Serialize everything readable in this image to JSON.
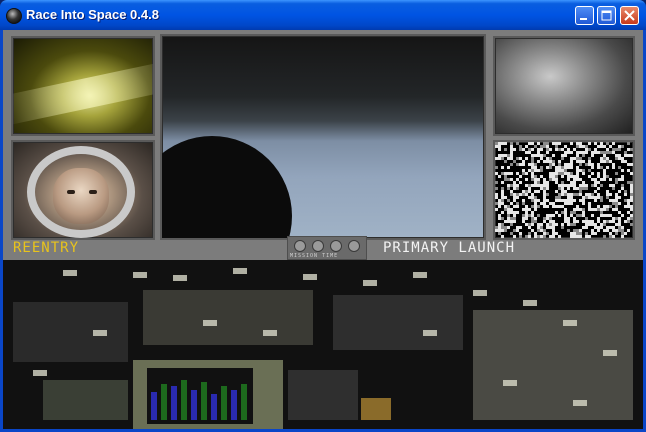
{
  "window": {
    "title": "Race Into Space 0.4.8",
    "icons": {
      "app": "app-icon",
      "minimize": "minimize-icon",
      "maximize": "maximize-icon",
      "close": "close-icon"
    }
  },
  "colors": {
    "titlebar": "#0054e3",
    "status_left": "#e8c31c",
    "status_right": "#f3f3f3",
    "panel": "#7c7c7c"
  },
  "status": {
    "left": "REENTRY",
    "right": "PRIMARY LAUNCH",
    "mission_time_label": "MISSION TIME"
  },
  "monitors": [
    {
      "name": "top-left",
      "content": "reentry-plasma"
    },
    {
      "name": "bottom-left",
      "content": "astronaut-face"
    },
    {
      "name": "main",
      "content": "earth-horizon"
    },
    {
      "name": "top-right",
      "content": "spacewalk"
    },
    {
      "name": "bottom-right",
      "content": "static-noise"
    }
  ]
}
